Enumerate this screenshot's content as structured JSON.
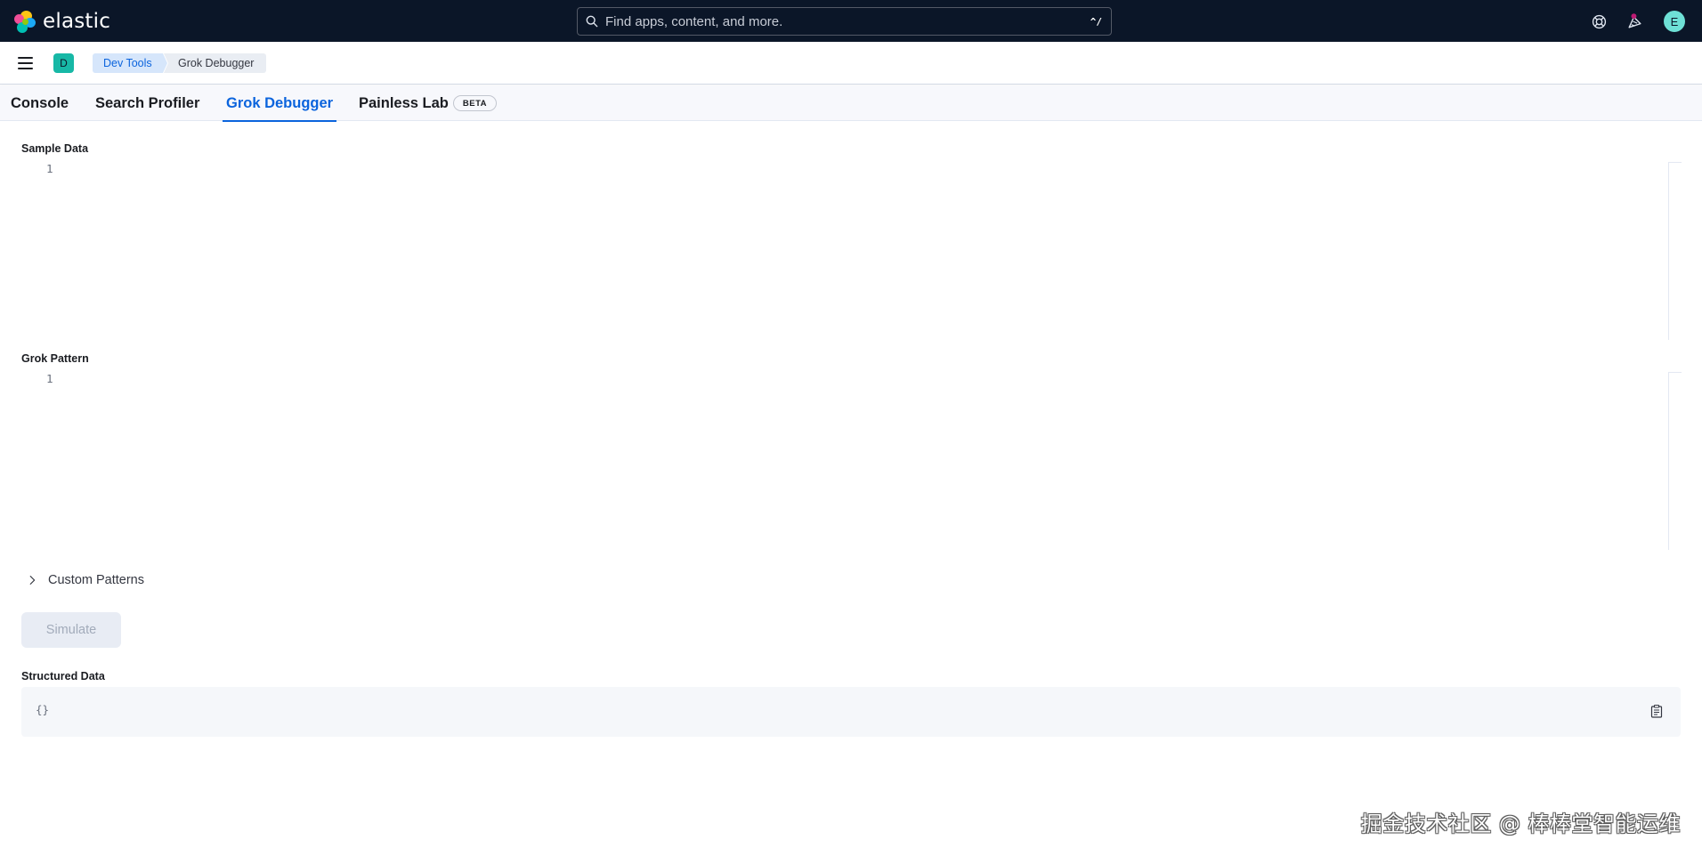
{
  "header": {
    "logo_text": "elastic",
    "search": {
      "placeholder": "Find apps, content, and more.",
      "shortcut": "^/"
    },
    "icons": [
      "help-icon",
      "news-feed-icon",
      "user-avatar"
    ],
    "user_initial": "E"
  },
  "breadcrumbs": {
    "space_initial": "D",
    "items": [
      "Dev Tools",
      "Grok Debugger"
    ]
  },
  "tabs": [
    {
      "label": "Console",
      "active": false
    },
    {
      "label": "Search Profiler",
      "active": false
    },
    {
      "label": "Grok Debugger",
      "active": true
    },
    {
      "label": "Painless Lab",
      "active": false,
      "badge": "BETA"
    }
  ],
  "main": {
    "sample_data": {
      "label": "Sample Data",
      "line_number": "1"
    },
    "grok_pattern": {
      "label": "Grok Pattern",
      "line_number": "1"
    },
    "custom_patterns_label": "Custom Patterns",
    "simulate_label": "Simulate",
    "structured_data": {
      "label": "Structured Data",
      "value": "{}"
    }
  },
  "watermark": "掘金技术社区 @ 棒棒堂智能运维",
  "colors": {
    "header_bg": "#0b1628",
    "accent": "#0b64dd",
    "space_avatar": "#17b8a6",
    "user_avatar": "#6ee0d6"
  }
}
